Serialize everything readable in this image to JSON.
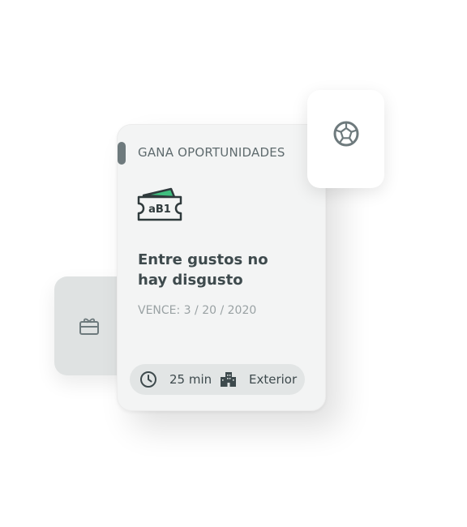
{
  "card": {
    "category": "GANA OPORTUNIDADES",
    "ticket_code": "aB1",
    "title_line1": "Entre gustos no",
    "title_line2": "hay disgusto",
    "expiry": "VENCE: 3 / 20 / 2020",
    "duration": "25 min",
    "location": "Exterior"
  },
  "icons": {
    "ticket": "ticket-icon",
    "clock": "clock-icon",
    "building": "building-icon",
    "soccer_ball": "soccer-ball-icon",
    "gift": "gift-card-icon"
  },
  "colors": {
    "accent_green": "#3fbf7f",
    "text_dark": "#3e4a4d",
    "text_muted": "#9aa2a4"
  }
}
